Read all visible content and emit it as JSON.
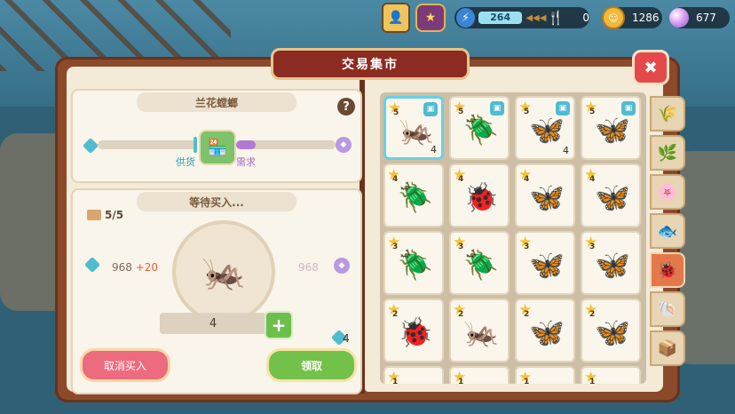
{
  "topbar": {
    "energy_value": "264",
    "food_value": "0",
    "coins": "1286",
    "gems": "677"
  },
  "market": {
    "title": "交易集市",
    "item_name": "兰花螳螂",
    "supply_label": "供货",
    "demand_label": "需求",
    "demand_level": 0.2,
    "waiting_title": "等待买入...",
    "slots": "5/5",
    "price_base": "968",
    "price_bonus": "+20",
    "price_right": "968",
    "quantity": "4",
    "owned": "4",
    "cancel_label": "取消买入",
    "claim_label": "领取"
  },
  "grid": [
    {
      "stars": "5",
      "icon": "orchid-mantis-icon",
      "glyph": "🦗",
      "count": "4",
      "cube": true,
      "selected": true
    },
    {
      "stars": "5",
      "icon": "stag-beetle-icon",
      "glyph": "🪲",
      "count": "",
      "cube": true
    },
    {
      "stars": "5",
      "icon": "blue-butterfly-icon",
      "glyph": "🦋",
      "count": "4",
      "cube": true
    },
    {
      "stars": "5",
      "icon": "yellow-butterfly-icon",
      "glyph": "🦋",
      "count": "",
      "cube": true
    },
    {
      "stars": "4",
      "icon": "blue-beetle-icon",
      "glyph": "🪲",
      "count": ""
    },
    {
      "stars": "4",
      "icon": "stink-bug-icon",
      "glyph": "🐞",
      "count": ""
    },
    {
      "stars": "4",
      "icon": "monarch-butterfly-icon",
      "glyph": "🦋",
      "count": ""
    },
    {
      "stars": "4",
      "icon": "luna-moth-icon",
      "glyph": "🦋",
      "count": ""
    },
    {
      "stars": "3",
      "icon": "firefly-icon",
      "glyph": "🪲",
      "count": ""
    },
    {
      "stars": "3",
      "icon": "green-scarab-icon",
      "glyph": "🪲",
      "count": ""
    },
    {
      "stars": "3",
      "icon": "blue-swallowtail-icon",
      "glyph": "🦋",
      "count": ""
    },
    {
      "stars": "3",
      "icon": "green-butterfly-icon",
      "glyph": "🦋",
      "count": ""
    },
    {
      "stars": "2",
      "icon": "ladybug-icon",
      "glyph": "🐞",
      "count": ""
    },
    {
      "stars": "2",
      "icon": "cricket-icon",
      "glyph": "🦗",
      "count": ""
    },
    {
      "stars": "2",
      "icon": "white-butterfly-icon",
      "glyph": "🦋",
      "count": ""
    },
    {
      "stars": "2",
      "icon": "yellow-swallowtail-icon",
      "glyph": "🦋",
      "count": ""
    },
    {
      "stars": "1",
      "icon": "bug-icon",
      "glyph": "🐛",
      "count": ""
    },
    {
      "stars": "1",
      "icon": "bug-icon",
      "glyph": "🐛",
      "count": ""
    },
    {
      "stars": "1",
      "icon": "bug-icon",
      "glyph": "🐛",
      "count": ""
    },
    {
      "stars": "1",
      "icon": "bug-icon",
      "glyph": "🐛",
      "count": ""
    }
  ],
  "tabs": [
    {
      "icon": "wheat-icon",
      "glyph": "🌾"
    },
    {
      "icon": "crop-icon",
      "glyph": "🌿"
    },
    {
      "icon": "flower-icon",
      "glyph": "🌸"
    },
    {
      "icon": "fish-icon",
      "glyph": "🐟"
    },
    {
      "icon": "beetle-tab-icon",
      "glyph": "🐞",
      "active": true
    },
    {
      "icon": "shell-icon",
      "glyph": "🐚"
    },
    {
      "icon": "misc-icon",
      "glyph": "📦"
    }
  ]
}
